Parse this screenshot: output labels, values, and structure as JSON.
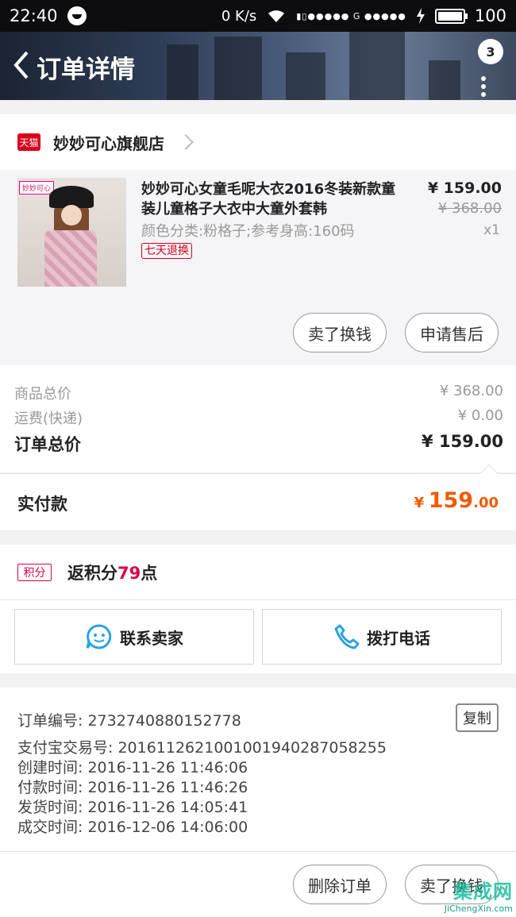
{
  "status_bar": {
    "time": "22:40",
    "speed": "0 K/s",
    "signal_text": "▮▯●●●●● G ●●●●●",
    "battery_text": "100"
  },
  "header": {
    "title": "订单详情",
    "badge_count": "3"
  },
  "shop": {
    "badge": "天猫",
    "name": "妙妙可心旗舰店"
  },
  "product": {
    "thumb_logo": "妙妙可心",
    "title": "妙妙可心女童毛呢大衣2016冬装新款童装儿童格子大衣中大童外套韩",
    "spec": "颜色分类:粉格子;参考身高:160码",
    "tag": "七天退换",
    "price": "¥ 159.00",
    "original_price": "¥ 368.00",
    "quantity": "x1",
    "buttons": {
      "sell": "卖了换钱",
      "after_sale": "申请售后"
    }
  },
  "summary": {
    "goods_total_label": "商品总价",
    "goods_total_value": "¥ 368.00",
    "shipping_label": "运费(快递)",
    "shipping_value": "¥ 0.00",
    "order_total_label": "订单总价",
    "order_total_value": "¥ 159.00"
  },
  "paid": {
    "label": "实付款",
    "currency": "¥",
    "integer": "159",
    "decimal": ".00"
  },
  "points": {
    "icon_text": "积分",
    "text_prefix": "返积分",
    "value": "79",
    "text_suffix": "点"
  },
  "contact": {
    "seller_label": "联系卖家",
    "call_label": "拨打电话"
  },
  "order_info": {
    "order_no": "订单编号: 2732740880152778",
    "copy_label": "复制",
    "alipay_no": "支付宝交易号: 2016112621001001940287058255",
    "created": "创建时间: 2016-11-26 11:46:06",
    "paid": "付款时间: 2016-11-26 11:46:26",
    "shipped": "发货时间: 2016-11-26 14:05:41",
    "completed": "成交时间: 2016-12-06 14:06:00"
  },
  "footer": {
    "delete_label": "删除订单",
    "sell_label": "卖了换钱"
  },
  "watermark": {
    "main": "集成网",
    "url": "JiChengXin.com"
  },
  "colors": {
    "accent_orange": "#f05a00",
    "tmall_red": "#d9001b",
    "points_pink": "#d9004f",
    "chat_blue": "#29a3e0"
  }
}
